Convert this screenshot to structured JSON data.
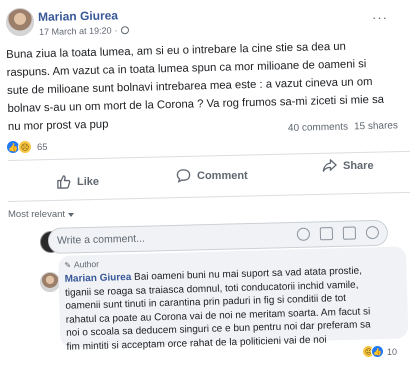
{
  "post": {
    "author_name": "Marian Giurea",
    "timestamp": "17 March at 19:20",
    "privacy_icon": "globe-icon",
    "more_icon": "more-icon",
    "text_lines": [
      "Buna ziua la toata lumea, am si eu o intrebare la cine stie sa dea un",
      "raspuns. Am vazut ca in toata lumea spun ca mor milioane de oameni si",
      "sute de milioane sunt bolnavi intrebarea mea este : a vazut cineva un om",
      "bolnav s-au un om mort de la Corona ? Va rog frumos sa-mi ziceti si mie sa",
      "nu mor prost va pup"
    ],
    "reaction_count": "65",
    "reaction_icons": [
      "like",
      "sad"
    ],
    "comments_count": "40 comments",
    "shares_count": "15 shares"
  },
  "actions": {
    "like_label": "Like",
    "comment_label": "Comment",
    "share_label": "Share"
  },
  "comments_section": {
    "sort_label": "Most relevant",
    "input_placeholder": "Write a comment...",
    "input_icons": [
      "emoji-icon",
      "camera-icon",
      "gif-icon",
      "sticker-icon"
    ]
  },
  "comment": {
    "badge": "Author",
    "author_name": "Marian Giurea",
    "text_lines": [
      " Bai oameni buni nu mai suport sa vad atata prostie,",
      "tiganii se roaga sa traiasca domnul, toti conducatorii inchid vamile,",
      "oamenii sunt tinuti in carantina prin paduri in fig si conditii de tot",
      "rahatul ca poate au Corona vai de noi ne meritam soarta. Am facut si",
      "noi o scoala sa deducem singuri ce e bun pentru noi dar preferam sa",
      "fim mintiti si acceptam orce rahat de la politicieni vai de noi"
    ],
    "reaction_count": "10"
  },
  "colors": {
    "link": "#385898",
    "like_blue": "#2078f4",
    "sad_yellow": "#f7c744",
    "muted": "#606770",
    "bubble": "#f0f2f5"
  }
}
